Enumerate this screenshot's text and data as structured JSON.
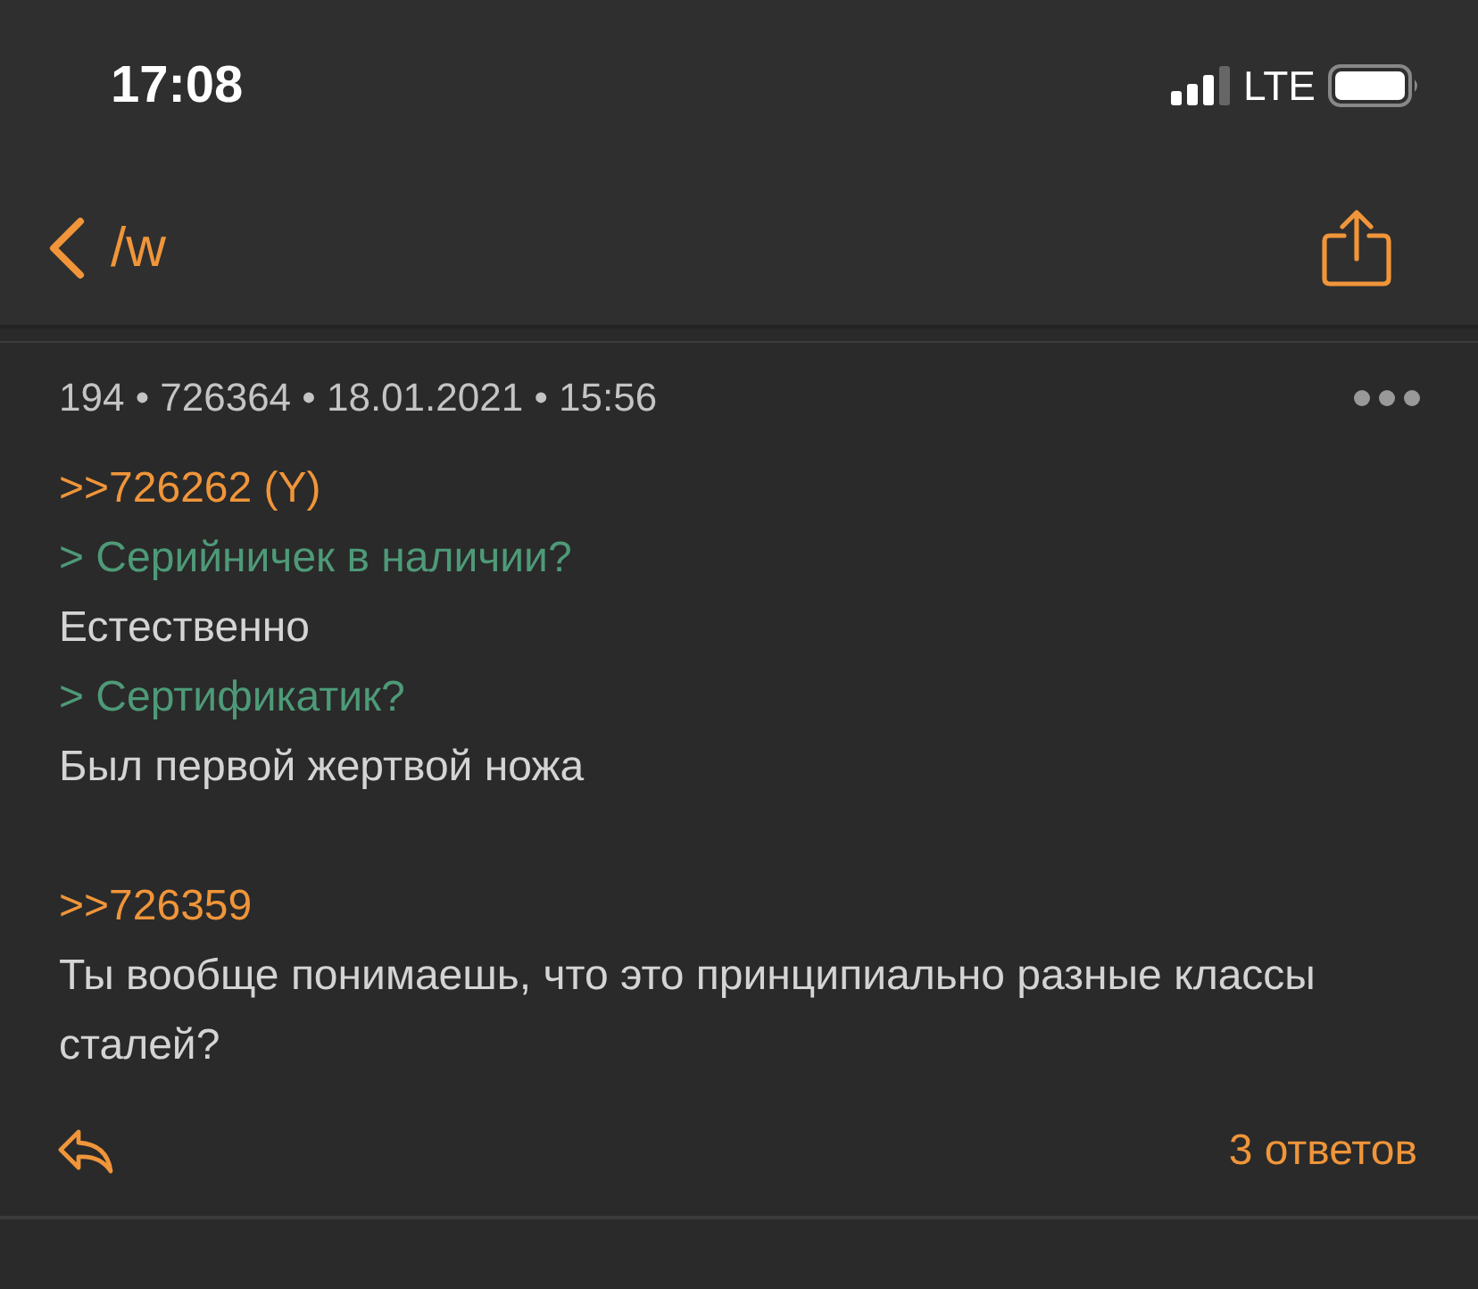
{
  "status_bar": {
    "time": "17:08",
    "network": "LTE"
  },
  "nav": {
    "title": "/w"
  },
  "post": {
    "meta": "194 • 726364 • 18.01.2021 • 15:56",
    "paragraphs": [
      [
        {
          "kind": "link",
          "text": ">>726262 (Y)"
        },
        {
          "kind": "quote",
          "text": "> Серийничек в наличии?"
        },
        {
          "kind": "text",
          "text": "Естественно"
        },
        {
          "kind": "quote",
          "text": "> Сертификатик?"
        },
        {
          "kind": "text",
          "text": "Был первой жертвой ножа"
        }
      ],
      [
        {
          "kind": "link",
          "text": ">>726359"
        },
        {
          "kind": "text",
          "text": "Ты вообще понимаешь, что это принципиально разные классы сталей?"
        }
      ]
    ],
    "replies": "3 ответов"
  }
}
